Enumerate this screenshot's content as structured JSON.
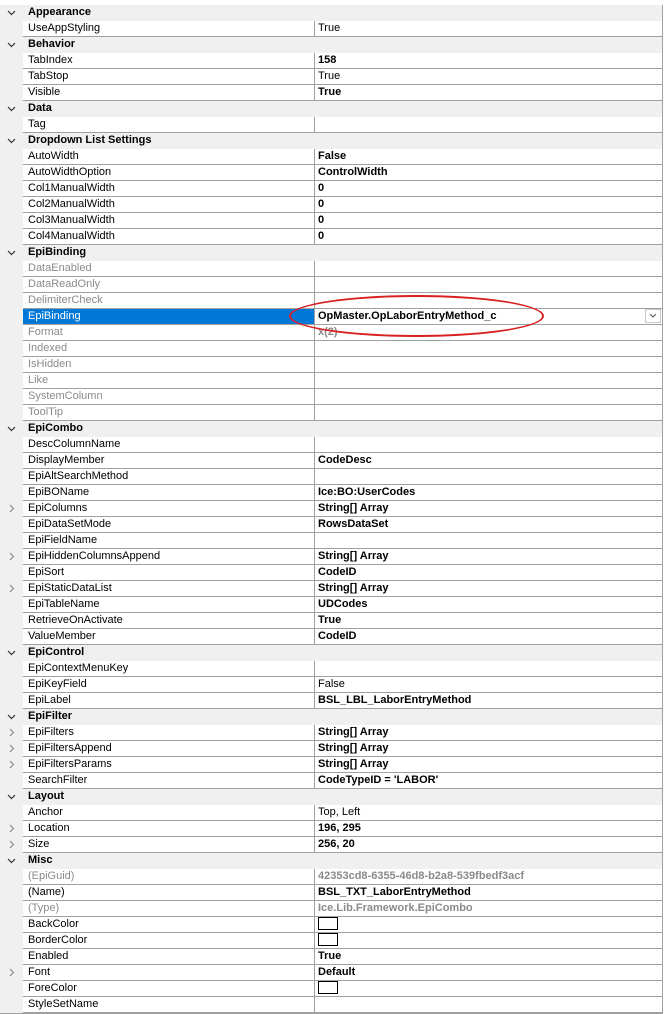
{
  "rows": [
    {
      "kind": "cat",
      "name": "Appearance"
    },
    {
      "kind": "prop",
      "name": "UseAppStyling",
      "value": "True",
      "style": "normal"
    },
    {
      "kind": "cat",
      "name": "Behavior"
    },
    {
      "kind": "prop",
      "name": "TabIndex",
      "value": "158",
      "style": "bold"
    },
    {
      "kind": "prop",
      "name": "TabStop",
      "value": "True",
      "style": "normal"
    },
    {
      "kind": "prop",
      "name": "Visible",
      "value": "True",
      "style": "bold"
    },
    {
      "kind": "cat",
      "name": "Data"
    },
    {
      "kind": "prop",
      "name": "Tag",
      "value": "",
      "style": "normal"
    },
    {
      "kind": "cat",
      "name": "Dropdown List Settings"
    },
    {
      "kind": "prop",
      "name": "AutoWidth",
      "value": "False",
      "style": "bold"
    },
    {
      "kind": "prop",
      "name": "AutoWidthOption",
      "value": "ControlWidth",
      "style": "bold"
    },
    {
      "kind": "prop",
      "name": "Col1ManualWidth",
      "value": "0",
      "style": "bold"
    },
    {
      "kind": "prop",
      "name": "Col2ManualWidth",
      "value": "0",
      "style": "bold"
    },
    {
      "kind": "prop",
      "name": "Col3ManualWidth",
      "value": "0",
      "style": "bold"
    },
    {
      "kind": "prop",
      "name": "Col4ManualWidth",
      "value": "0",
      "style": "bold"
    },
    {
      "kind": "cat",
      "name": "EpiBinding"
    },
    {
      "kind": "prop",
      "name": "DataEnabled",
      "value": "",
      "style": "normal",
      "disabled": true
    },
    {
      "kind": "prop",
      "name": "DataReadOnly",
      "value": "",
      "style": "normal",
      "disabled": true
    },
    {
      "kind": "prop",
      "name": "DelimiterCheck",
      "value": "",
      "style": "normal",
      "disabled": true
    },
    {
      "kind": "prop",
      "name": "EpiBinding",
      "value": "OpMaster.OpLaborEntryMethod_c",
      "style": "bold",
      "selected": true,
      "dropdown": true
    },
    {
      "kind": "prop",
      "name": "Format",
      "value": "x(2)",
      "style": "grey",
      "disabled": true
    },
    {
      "kind": "prop",
      "name": "Indexed",
      "value": "",
      "style": "normal",
      "disabled": true
    },
    {
      "kind": "prop",
      "name": "IsHidden",
      "value": "",
      "style": "normal",
      "disabled": true
    },
    {
      "kind": "prop",
      "name": "Like",
      "value": "",
      "style": "normal",
      "disabled": true
    },
    {
      "kind": "prop",
      "name": "SystemColumn",
      "value": "",
      "style": "normal",
      "disabled": true
    },
    {
      "kind": "prop",
      "name": "ToolTip",
      "value": "",
      "style": "normal",
      "disabled": true
    },
    {
      "kind": "cat",
      "name": "EpiCombo"
    },
    {
      "kind": "prop",
      "name": "DescColumnName",
      "value": "",
      "style": "normal"
    },
    {
      "kind": "prop",
      "name": "DisplayMember",
      "value": "CodeDesc",
      "style": "bold"
    },
    {
      "kind": "prop",
      "name": "EpiAltSearchMethod",
      "value": "",
      "style": "normal"
    },
    {
      "kind": "prop",
      "name": "EpiBOName",
      "value": "Ice:BO:UserCodes",
      "style": "bold"
    },
    {
      "kind": "prop",
      "name": "EpiColumns",
      "value": "String[] Array",
      "style": "bold",
      "expandable": true
    },
    {
      "kind": "prop",
      "name": "EpiDataSetMode",
      "value": "RowsDataSet",
      "style": "bold"
    },
    {
      "kind": "prop",
      "name": "EpiFieldName",
      "value": "",
      "style": "normal"
    },
    {
      "kind": "prop",
      "name": "EpiHiddenColumnsAppend",
      "value": "String[] Array",
      "style": "bold",
      "expandable": true
    },
    {
      "kind": "prop",
      "name": "EpiSort",
      "value": "CodeID",
      "style": "bold"
    },
    {
      "kind": "prop",
      "name": "EpiStaticDataList",
      "value": "String[] Array",
      "style": "bold",
      "expandable": true
    },
    {
      "kind": "prop",
      "name": "EpiTableName",
      "value": "UDCodes",
      "style": "bold"
    },
    {
      "kind": "prop",
      "name": "RetrieveOnActivate",
      "value": "True",
      "style": "bold"
    },
    {
      "kind": "prop",
      "name": "ValueMember",
      "value": "CodeID",
      "style": "bold"
    },
    {
      "kind": "cat",
      "name": "EpiControl"
    },
    {
      "kind": "prop",
      "name": "EpiContextMenuKey",
      "value": "",
      "style": "normal"
    },
    {
      "kind": "prop",
      "name": "EpiKeyField",
      "value": "False",
      "style": "normal"
    },
    {
      "kind": "prop",
      "name": "EpiLabel",
      "value": "BSL_LBL_LaborEntryMethod",
      "style": "bold"
    },
    {
      "kind": "cat",
      "name": "EpiFilter"
    },
    {
      "kind": "prop",
      "name": "EpiFilters",
      "value": "String[] Array",
      "style": "bold",
      "expandable": true
    },
    {
      "kind": "prop",
      "name": "EpiFiltersAppend",
      "value": "String[] Array",
      "style": "bold",
      "expandable": true
    },
    {
      "kind": "prop",
      "name": "EpiFiltersParams",
      "value": "String[] Array",
      "style": "bold",
      "expandable": true
    },
    {
      "kind": "prop",
      "name": "SearchFilter",
      "value": "CodeTypeID = 'LABOR'",
      "style": "bold"
    },
    {
      "kind": "cat",
      "name": "Layout"
    },
    {
      "kind": "prop",
      "name": "Anchor",
      "value": "Top, Left",
      "style": "normal"
    },
    {
      "kind": "prop",
      "name": "Location",
      "value": "196, 295",
      "style": "bold",
      "expandable": true
    },
    {
      "kind": "prop",
      "name": "Size",
      "value": "256, 20",
      "style": "bold",
      "expandable": true
    },
    {
      "kind": "cat",
      "name": "Misc"
    },
    {
      "kind": "prop",
      "name": "(EpiGuid)",
      "value": "42353cd8-6355-46d8-b2a8-539fbedf3acf",
      "style": "grey",
      "disabled": true
    },
    {
      "kind": "prop",
      "name": "(Name)",
      "value": "BSL_TXT_LaborEntryMethod",
      "style": "bold"
    },
    {
      "kind": "prop",
      "name": "(Type)",
      "value": "Ice.Lib.Framework.EpiCombo",
      "style": "grey",
      "disabled": true
    },
    {
      "kind": "prop",
      "name": "BackColor",
      "value": "",
      "style": "normal",
      "swatch": true
    },
    {
      "kind": "prop",
      "name": "BorderColor",
      "value": "",
      "style": "normal",
      "swatch": true
    },
    {
      "kind": "prop",
      "name": "Enabled",
      "value": "True",
      "style": "bold"
    },
    {
      "kind": "prop",
      "name": "Font",
      "value": "Default",
      "style": "bold",
      "expandable": true
    },
    {
      "kind": "prop",
      "name": "ForeColor",
      "value": "",
      "style": "normal",
      "swatch": true
    },
    {
      "kind": "prop",
      "name": "StyleSetName",
      "value": "",
      "style": "normal"
    }
  ],
  "colors": {
    "selection": "#0078d7",
    "annotation": "#d92222",
    "gutter": "#f0f0f0"
  }
}
